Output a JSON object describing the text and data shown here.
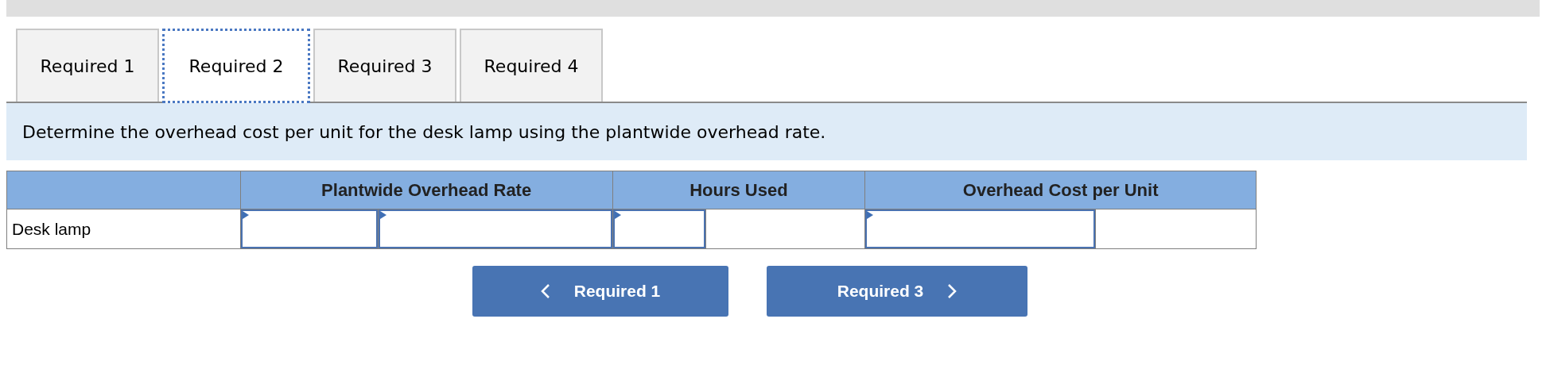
{
  "tabs": [
    {
      "label": "Required 1",
      "selected": false
    },
    {
      "label": "Required 2",
      "selected": true
    },
    {
      "label": "Required 3",
      "selected": false
    },
    {
      "label": "Required 4",
      "selected": false
    }
  ],
  "instruction": "Determine the overhead cost per unit for the desk lamp using the plantwide overhead rate.",
  "table": {
    "columns": [
      "",
      "Plantwide Overhead Rate",
      "Hours Used",
      "Overhead Cost per Unit"
    ],
    "rows": [
      {
        "label": "Desk lamp",
        "cells": [
          {
            "kind": "input"
          },
          {
            "kind": "input"
          },
          {
            "kind": "input"
          },
          {
            "kind": "blank"
          },
          {
            "kind": "input"
          },
          {
            "kind": "blank"
          }
        ]
      }
    ]
  },
  "nav": {
    "previous": "Required 1",
    "next": "Required 3"
  }
}
